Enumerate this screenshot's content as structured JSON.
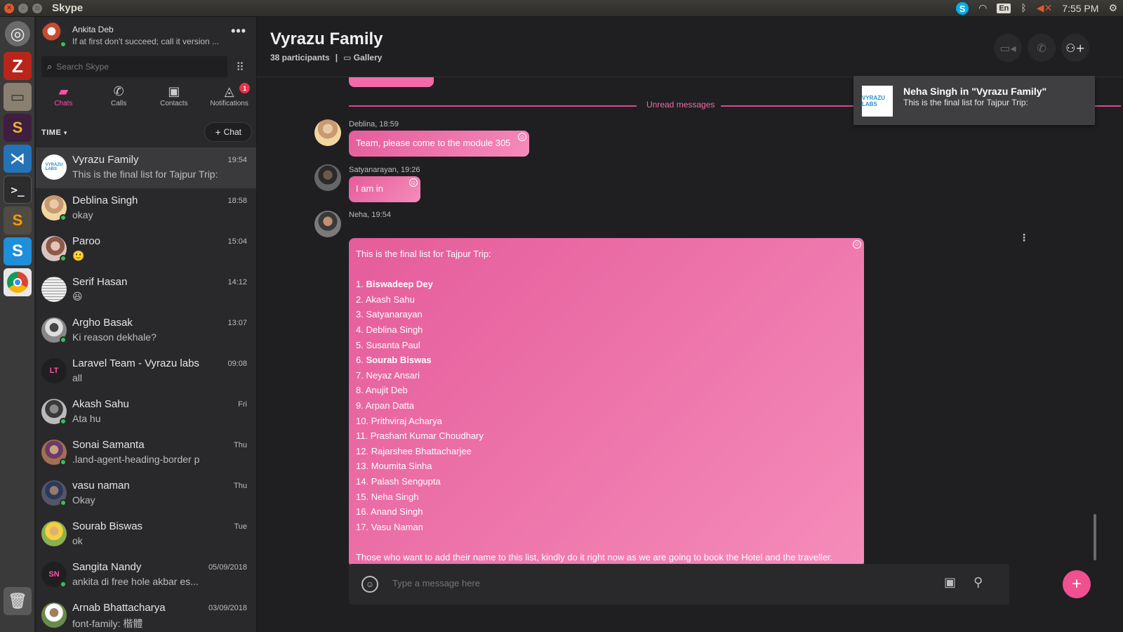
{
  "window": {
    "title": "Skype",
    "tray": {
      "language": "En",
      "clock": "7:55 PM"
    }
  },
  "launcher": {
    "apps": [
      "ubuntu-dash",
      "filezilla",
      "files",
      "slack",
      "vscode",
      "terminal",
      "sublime-text",
      "skype",
      "chrome",
      "trash"
    ]
  },
  "profile": {
    "name": "Ankita Deb",
    "mood": "If at first don't succeed; call it version ..."
  },
  "search": {
    "placeholder": "Search Skype"
  },
  "tabs": [
    {
      "label": "Chats",
      "icon": "chat-icon",
      "active": true
    },
    {
      "label": "Calls",
      "icon": "phone-icon"
    },
    {
      "label": "Contacts",
      "icon": "contacts-icon"
    },
    {
      "label": "Notifications",
      "icon": "bell-icon",
      "badge": "1"
    }
  ],
  "sort": {
    "label": "TIME",
    "new_chat_label": "Chat"
  },
  "chats": [
    {
      "name": "Vyrazu Family",
      "preview": "This is the final list for Tajpur Trip:",
      "time": "19:54",
      "active": true
    },
    {
      "name": "Deblina Singh",
      "preview": "okay",
      "time": "18:58",
      "online": true
    },
    {
      "name": "Paroo",
      "preview": "🙂",
      "time": "15:04",
      "online": true
    },
    {
      "name": "Serif Hasan",
      "preview": "😆",
      "time": "14:12"
    },
    {
      "name": "Argho Basak",
      "preview": "Ki reason dekhale?",
      "time": "13:07",
      "online": true
    },
    {
      "name": "Laravel Team - Vyrazu labs",
      "preview": "all",
      "time": "09:08",
      "initials": "LT"
    },
    {
      "name": "Akash Sahu",
      "preview": "Ata hu",
      "time": "Fri",
      "online": true
    },
    {
      "name": "Sonai Samanta",
      "preview": ".land-agent-heading-border p",
      "time": "Thu",
      "online": true
    },
    {
      "name": "vasu naman",
      "preview": "Okay",
      "time": "Thu",
      "online": true
    },
    {
      "name": "Sourab Biswas",
      "preview": "ok",
      "time": "Tue"
    },
    {
      "name": "Sangita Nandy",
      "preview": "ankita di free hole akbar es...",
      "time": "05/09/2018",
      "initials": "SN",
      "online": true
    },
    {
      "name": "Arnab Bhattacharya",
      "preview": "font-family: 楷體",
      "time": "03/09/2018"
    }
  ],
  "conversation": {
    "title": "Vyrazu Family",
    "participants": "38 participants",
    "separator": "|",
    "gallery": "Gallery",
    "unread_label": "Unread messages",
    "messages": [
      {
        "sender": "Deblina, 18:59",
        "text": "Team, please come to the module 305"
      },
      {
        "sender": "Satyanarayan, 19:26",
        "text": "I am in"
      },
      {
        "sender": "Neha, 19:54",
        "intro": "This is the final list for Tajpur Trip:",
        "list": [
          {
            "num": "1.",
            "name": "Biswadeep Dey",
            "bold": true
          },
          {
            "num": "2.",
            "name": "Akash Sahu"
          },
          {
            "num": "3.",
            "name": "Satyanarayan"
          },
          {
            "num": "4.",
            "name": "Deblina Singh"
          },
          {
            "num": "5.",
            "name": "Susanta Paul"
          },
          {
            "num": "6.",
            "name": "Sourab Biswas",
            "bold": true
          },
          {
            "num": "7.",
            "name": "Neyaz Ansari"
          },
          {
            "num": "8.",
            "name": "Anujit Deb"
          },
          {
            "num": "9.",
            "name": "Arpan Datta"
          },
          {
            "num": "10.",
            "name": "Prithviraj Acharya"
          },
          {
            "num": "11.",
            "name": "Prashant Kumar Choudhary"
          },
          {
            "num": "12.",
            "name": "Rajarshee Bhattacharjee"
          },
          {
            "num": "13.",
            "name": "Moumita Sinha"
          },
          {
            "num": "14.",
            "name": "Palash Sengupta"
          },
          {
            "num": "15.",
            "name": "Neha Singh"
          },
          {
            "num": "16.",
            "name": "Anand Singh"
          },
          {
            "num": "17.",
            "name": "Vasu Naman"
          }
        ],
        "outro": "Those who want to add their name to this list, kindly do it right now as we are going to book the Hotel and the traveller."
      }
    ]
  },
  "notification": {
    "title": "Neha Singh in \"Vyrazu Family\"",
    "body": "This is the final list for Tajpur Trip:",
    "avatar_text": "VYRAZU LABS"
  },
  "composer": {
    "placeholder": "Type a message here"
  },
  "colors": {
    "accent": "#f26aa8",
    "bubble_start": "#e55c9b",
    "bubble_end": "#f58cba",
    "presence": "#35c15a"
  }
}
